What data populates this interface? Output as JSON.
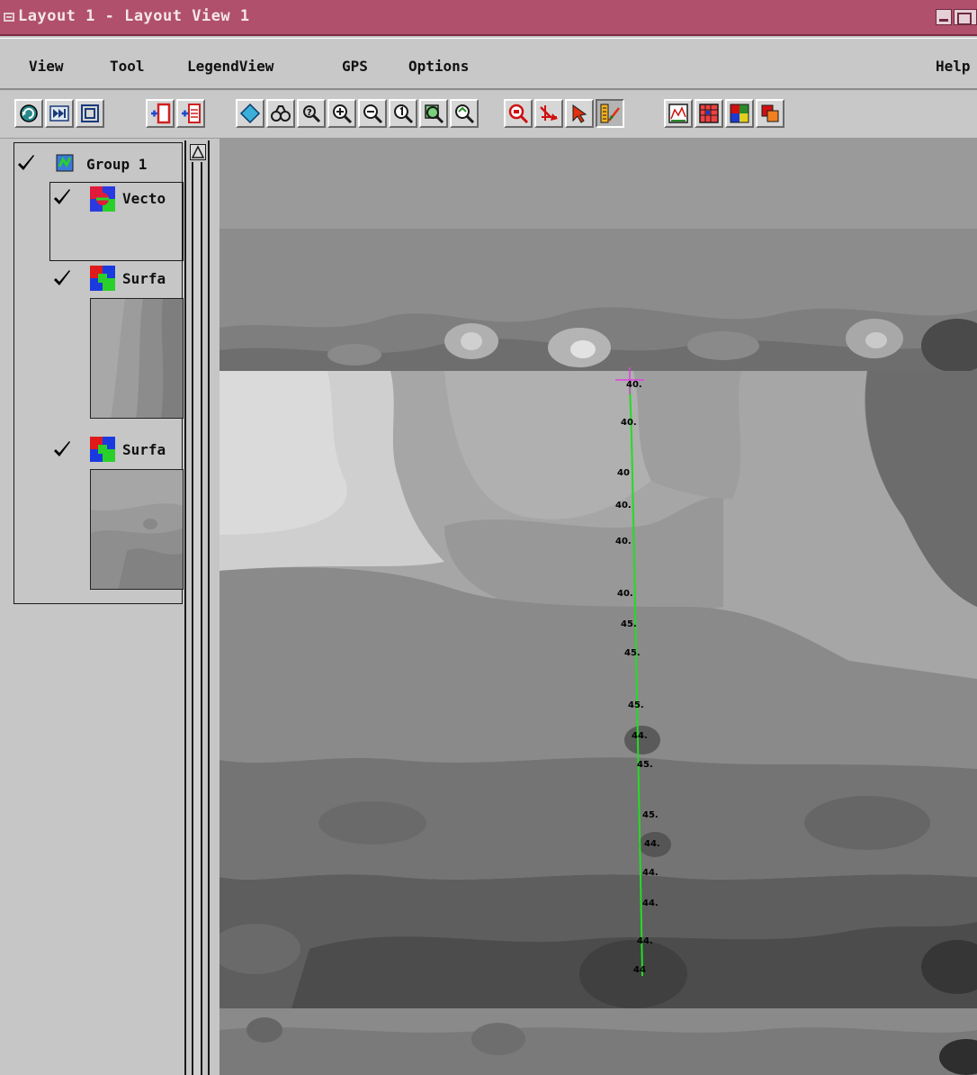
{
  "window": {
    "title": "Layout 1 - Layout View 1"
  },
  "menu": {
    "items": [
      "View",
      "Tool",
      "LegendView",
      "GPS",
      "Options"
    ],
    "help": "Help"
  },
  "toolbar": {
    "buttons": [
      "redraw-icon",
      "redraw-step-icon",
      "full-view-icon",
      "add-layer-icon",
      "add-layer-list-icon",
      "select-icon",
      "zoom-binocular-icon",
      "zoom-query-icon",
      "zoom-in-icon",
      "zoom-out-icon",
      "zoom-1x-icon",
      "zoom-area-icon",
      "zoom-previous-icon",
      "zoom-box-red-icon",
      "pan-arrow-icon",
      "pointer-icon",
      "measure-tool-icon",
      "histogram-icon",
      "grid-edit-icon",
      "color-map-icon",
      "layer-stack-icon"
    ],
    "pressed": "measure-tool-icon"
  },
  "legend": {
    "group_label": "Group 1",
    "layers": [
      {
        "label": "Vecto",
        "type": "vector"
      },
      {
        "label": "Surfa",
        "type": "surface"
      },
      {
        "label": "Surfa",
        "type": "surface"
      }
    ]
  },
  "map": {
    "profile_color": "#22dd22",
    "cursor_color": "#e040e0",
    "elevation_labels": [
      "40.",
      "40.",
      "40",
      "40.",
      "40.",
      "40.",
      "45.",
      "45.",
      "45.",
      "44.",
      "45.",
      "45.",
      "44.",
      "44.",
      "44.",
      "44.",
      "44"
    ]
  }
}
